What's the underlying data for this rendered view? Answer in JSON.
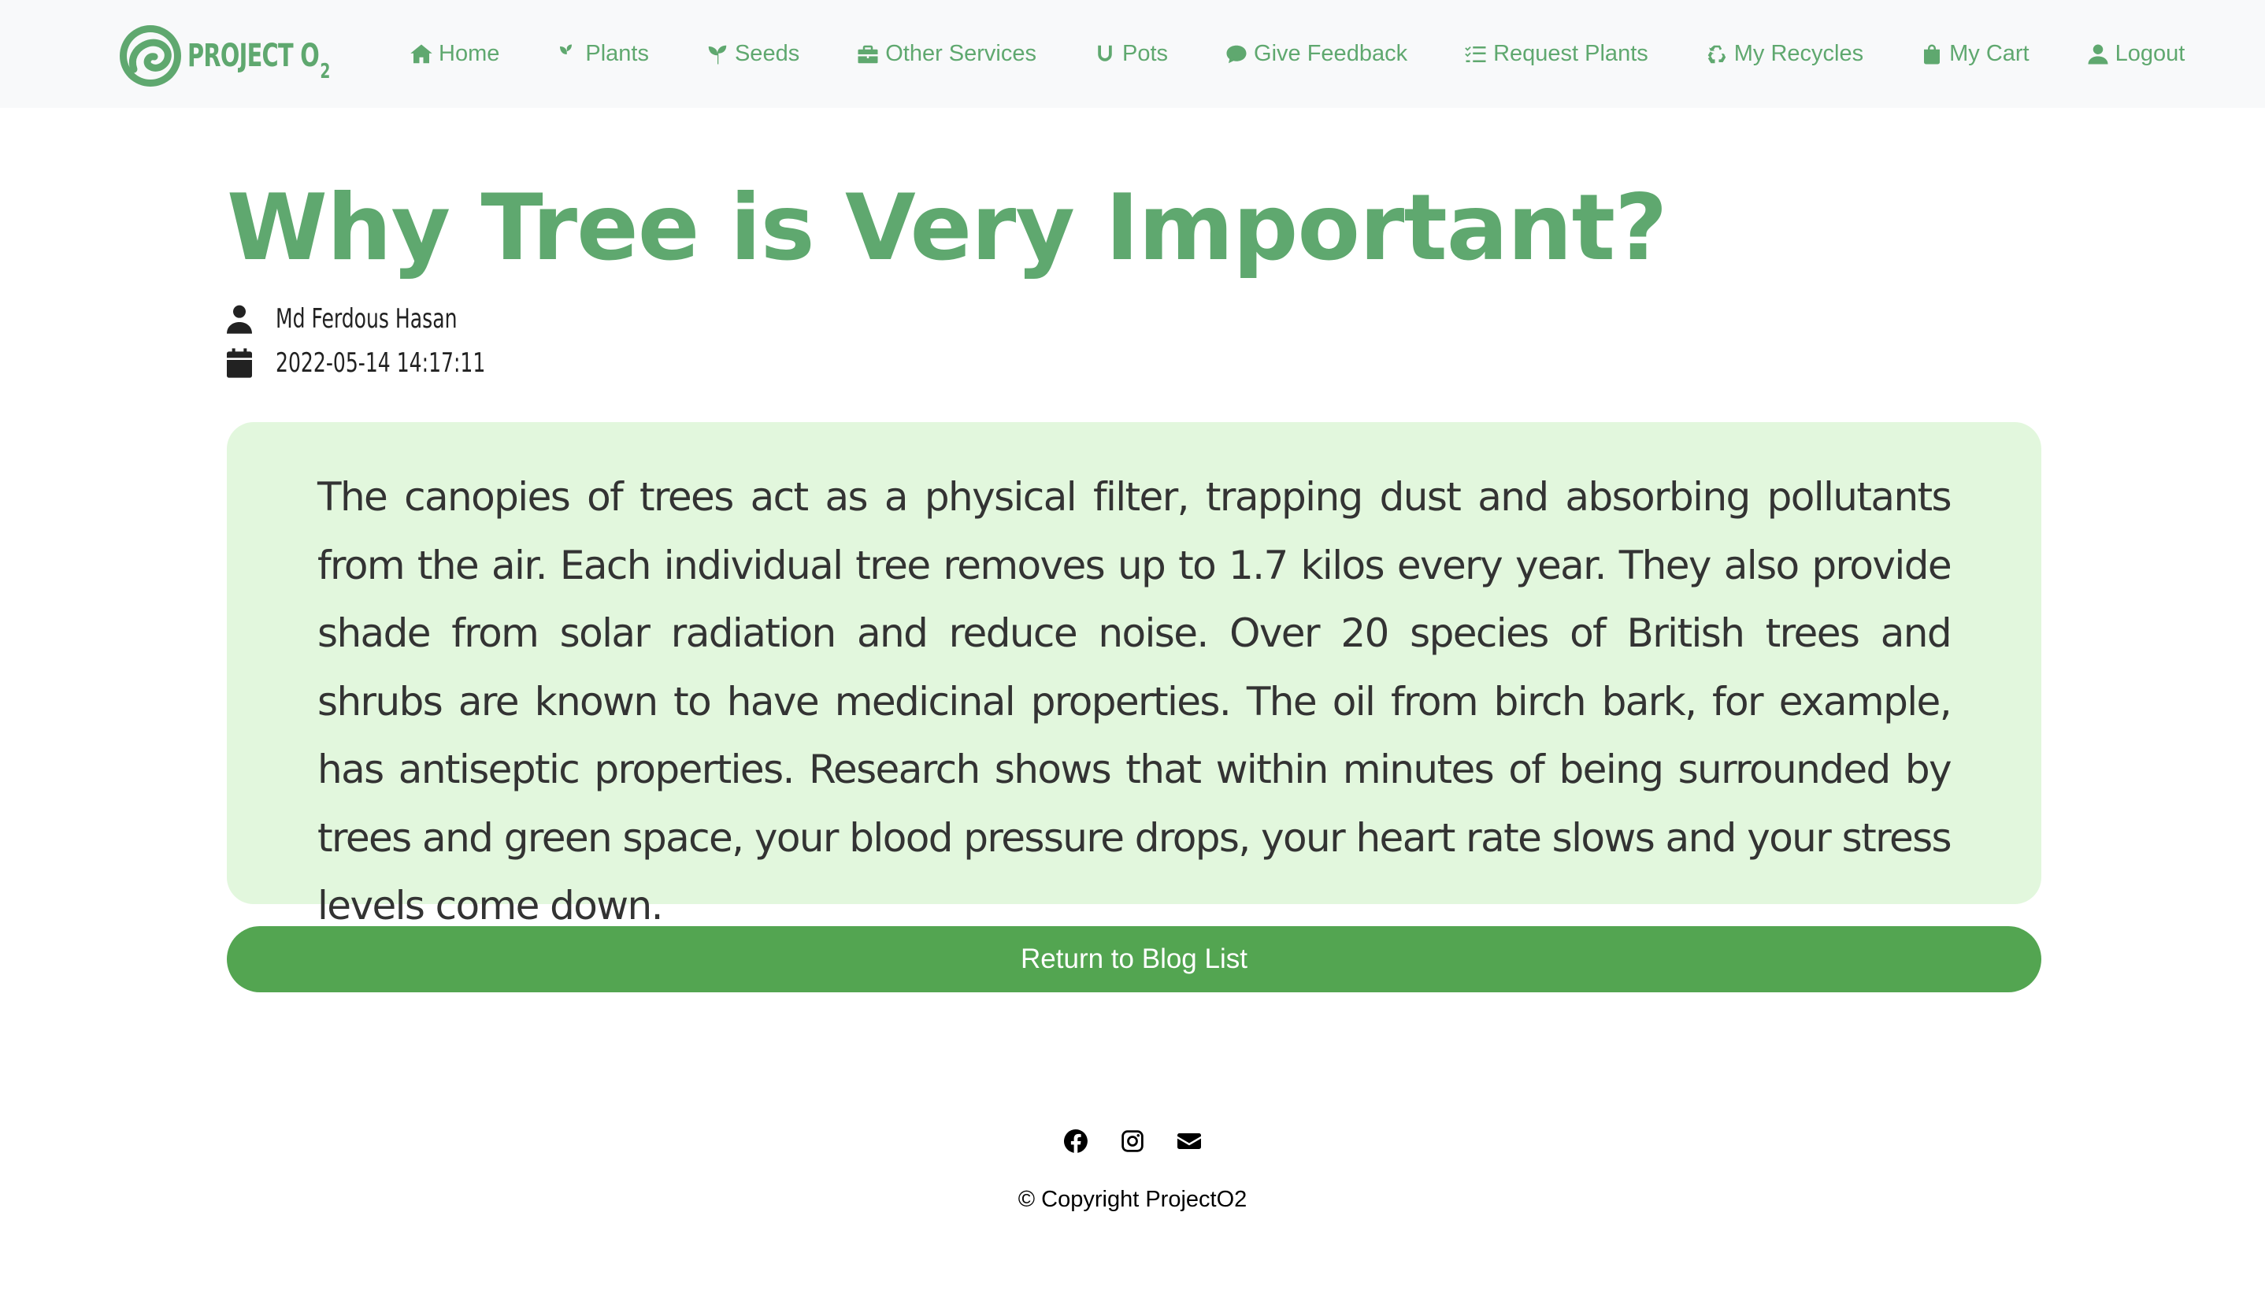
{
  "brand": {
    "name": "PROJECT O",
    "subscript": "2"
  },
  "nav": {
    "items": [
      {
        "label": "Home",
        "icon": "home-icon"
      },
      {
        "label": "Plants",
        "icon": "plant-icon"
      },
      {
        "label": "Seeds",
        "icon": "seedling-icon"
      },
      {
        "label": "Other Services",
        "icon": "briefcase-icon"
      },
      {
        "label": "Pots",
        "icon": "pot-icon"
      },
      {
        "label": "Give Feedback",
        "icon": "comment-icon"
      },
      {
        "label": "Request Plants",
        "icon": "list-check-icon"
      },
      {
        "label": "My Recycles",
        "icon": "recycle-icon"
      },
      {
        "label": "My Cart",
        "icon": "bag-icon"
      },
      {
        "label": "Logout",
        "icon": "user-icon"
      }
    ]
  },
  "article": {
    "title": "Why Tree is Very Important?",
    "author": "Md Ferdous Hasan",
    "date": "2022-05-14 14:17:11",
    "body": "The canopies of trees act as a physical filter, trapping dust and absorbing pollutants from the air. Each individual tree removes up to 1.7 kilos every year. They also provide shade from solar radiation and reduce noise. Over 20 species of British trees and shrubs are known to have medicinal properties. The oil from birch bark, for example, has antiseptic properties. Research shows that within minutes of being surrounded by trees and green space, your blood pressure drops, your heart rate slows and your stress levels come down."
  },
  "return_button": {
    "label": "Return to Blog List"
  },
  "footer": {
    "social_icons": [
      "facebook-icon",
      "instagram-icon",
      "envelope-icon"
    ],
    "copyright": "© Copyright ProjectO2"
  },
  "colors": {
    "brand": "#5fa86f",
    "card_bg": "#e2f7dd",
    "button": "#53a551",
    "navbar_bg": "#f8f9fa"
  }
}
